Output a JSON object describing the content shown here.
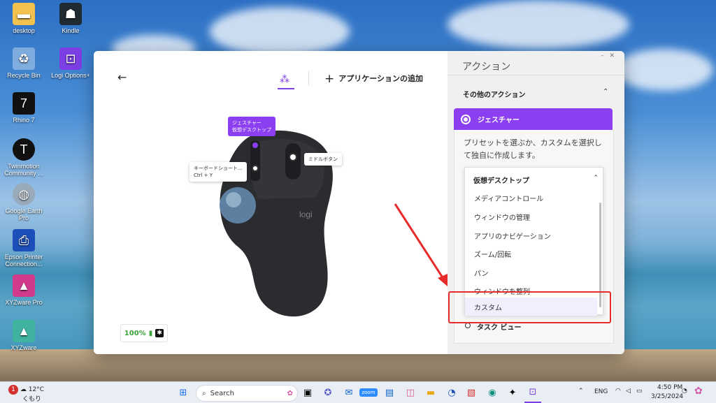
{
  "desktop": {
    "icons": [
      {
        "label": "desktop",
        "icon": "folder-icon"
      },
      {
        "label": "Kindle",
        "icon": "kindle-icon"
      },
      {
        "label": "Recycle Bin",
        "icon": "recycle-bin-icon"
      },
      {
        "label": "Logi Options+",
        "icon": "logi-options-icon"
      },
      {
        "label": "Rhino 7",
        "icon": "rhino-icon"
      },
      {
        "label": "Twinmotion Community ...",
        "icon": "twinmotion-icon"
      },
      {
        "label": "Google Earth Pro",
        "icon": "google-earth-icon"
      },
      {
        "label": "Epson Printer Connection...",
        "icon": "epson-icon"
      },
      {
        "label": "XYZware Pro",
        "icon": "xyzware-pro-icon"
      },
      {
        "label": "XYZware",
        "icon": "xyzware-icon"
      }
    ]
  },
  "app": {
    "add_app_label": "アプリケーションの追加",
    "tooltips": {
      "gesture_line1": "ジェスチャー",
      "gesture_line2": "仮想デスクトップ",
      "keyboard_line1": "キーボードショート...",
      "keyboard_line2": "Ctrl + Y",
      "middle": "ミドルボタン"
    },
    "battery": "100%",
    "mouse_brand": "logi"
  },
  "panel": {
    "title": "アクション",
    "other_actions": "その他のアクション",
    "gesture_label": "ジェスチャー",
    "description": "プリセットを選ぶか、カスタムを選択して独自に作成します。",
    "dropdown_selected": "仮想デスクトップ",
    "options": [
      "メディアコントロール",
      "ウィンドウの管理",
      "アプリのナビゲーション",
      "ズーム/回転",
      "パン",
      "ウィンドウを整列",
      "カスタム"
    ],
    "peek_label": "タスク ビュー"
  },
  "taskbar": {
    "weather_temp": "12°C",
    "weather_desc": "くもり",
    "weather_badge": "1",
    "search_placeholder": "Search",
    "lang": "ENG",
    "time": "4:50 PM",
    "date": "3/25/2024",
    "zoom_label": "zoom"
  }
}
